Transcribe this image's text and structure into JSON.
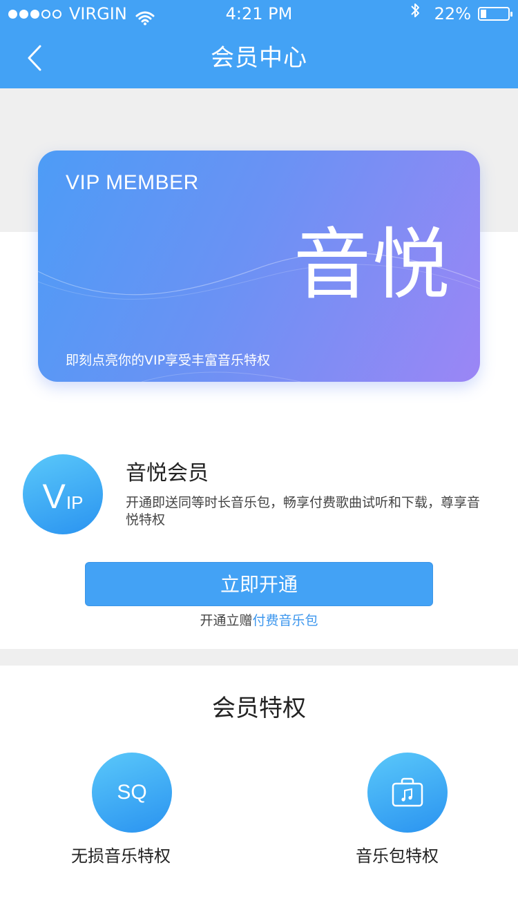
{
  "status_bar": {
    "carrier": "VIRGIN",
    "time": "4:21 PM",
    "battery_text": "22%",
    "battery_level": 0.22
  },
  "nav": {
    "title": "会员中心"
  },
  "card": {
    "label": "VIP MEMBER",
    "brand": "音悦",
    "tagline": "即刻点亮你的VIP享受丰富音乐特权"
  },
  "member": {
    "badge_v": "V",
    "badge_ip": "IP",
    "title": "音悦会员",
    "description": "开通即送同等时长音乐包，畅享付费歌曲试听和下载，尊享音悦特权",
    "button": "立即开通",
    "gift_prefix": "开通立赠",
    "gift_link": "付费音乐包"
  },
  "privileges": {
    "title": "会员特权",
    "items": [
      {
        "icon": "SQ",
        "label": "无损音乐特权"
      },
      {
        "icon": "music-package-icon",
        "label": "音乐包特权"
      }
    ]
  },
  "colors": {
    "primary": "#43a2f5",
    "card_start": "#4d9cf6",
    "card_end": "#9b86f5"
  }
}
